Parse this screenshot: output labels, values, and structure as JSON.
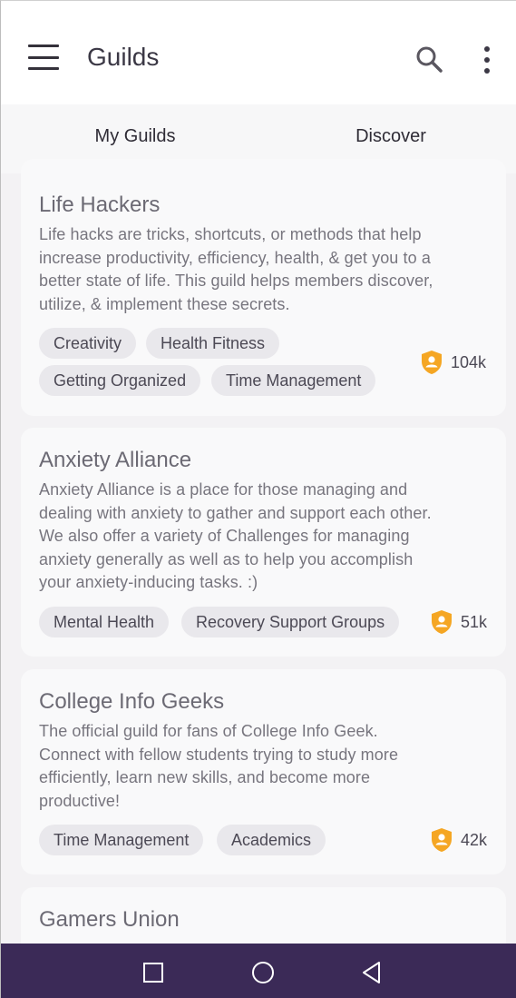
{
  "appbar": {
    "title": "Guilds",
    "menu_icon": "hamburger-menu-icon",
    "search_icon": "search-icon",
    "more_icon": "more-vertical-icon"
  },
  "tabs": [
    {
      "label": "My Guilds",
      "selected": false
    },
    {
      "label": "Discover",
      "selected": true
    }
  ],
  "colors": {
    "accent": "#3b2a57",
    "badge_orange": "#f5a623",
    "tag_bg": "#e9e8ec"
  },
  "guilds": [
    {
      "title": "Life Hackers",
      "description_lines": [
        "Life hacks are tricks, shortcuts, or methods that help",
        "increase productivity, efficiency, health, & get you to a",
        "better state of life. This guild helps members discover,",
        "utilize, & implement these secrets."
      ],
      "tags": [
        "Creativity",
        "Health Fitness",
        "Getting Organized",
        "Time Management"
      ],
      "members": "104k"
    },
    {
      "title": "Anxiety Alliance",
      "description_lines": [
        "Anxiety Alliance is a place for those managing and",
        "dealing with anxiety to gather and support each other.",
        "We also offer a variety of Challenges for managing",
        "anxiety generally as well as to help you accomplish",
        "your anxiety-inducing tasks. :)"
      ],
      "tags": [
        "Mental Health",
        "Recovery Support Groups"
      ],
      "members": "51k"
    },
    {
      "title": "College Info Geeks",
      "description_lines": [
        "The official guild for fans of College Info Geek.",
        "Connect with fellow students trying to study more",
        "efficiently, learn new skills, and become more",
        "productive!"
      ],
      "tags": [
        "Time Management",
        "Academics"
      ],
      "members": "42k"
    },
    {
      "title": "Gamers Union"
    }
  ],
  "system_nav": {
    "recents_icon": "square-recents-icon",
    "home_icon": "circle-home-icon",
    "back_icon": "triangle-back-icon"
  }
}
